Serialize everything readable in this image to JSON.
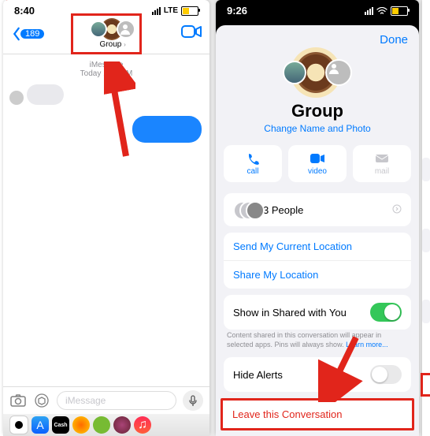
{
  "left": {
    "time": "8:40",
    "network": "LTE",
    "back_count": "189",
    "group_label": "Group",
    "timestamp_line1": "iMessage",
    "timestamp_line2": "Today 1:19 PM",
    "input_placeholder": "iMessage"
  },
  "right": {
    "time": "9:26",
    "done": "Done",
    "title": "Group",
    "change": "Change Name and Photo",
    "actions": {
      "call": "call",
      "video": "video",
      "mail": "mail"
    },
    "people": "3 People",
    "send_loc": "Send My Current Location",
    "share_loc": "Share My Location",
    "shared": "Show in Shared with You",
    "shared_caption": "Content shared in this conversation will appear in selected apps. Pins will always show. ",
    "learn": "Learn more...",
    "hide": "Hide Alerts",
    "leave": "Leave this Conversation"
  }
}
